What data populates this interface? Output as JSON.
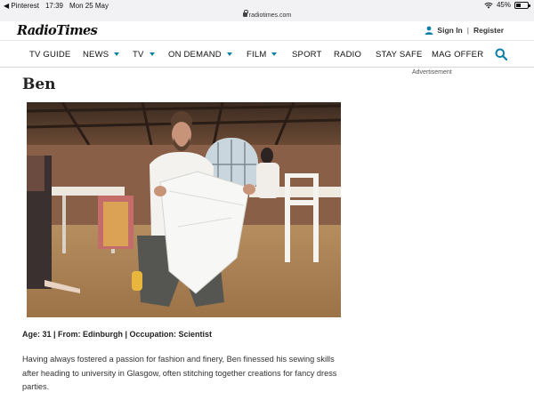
{
  "status_bar": {
    "app": "◀ Pinterest",
    "time": "17:39",
    "date": "Mon 25 May",
    "battery": "45%",
    "battery_level": 0.45
  },
  "url_bar": {
    "domain": "radiotimes.com"
  },
  "header": {
    "logo": "RadioTimes",
    "sign_in": "Sign In",
    "divider": "|",
    "register": "Register"
  },
  "nav": {
    "items": [
      {
        "label": "TV GUIDE",
        "caret": false
      },
      {
        "label": "NEWS",
        "caret": true
      },
      {
        "label": "TV",
        "caret": true
      },
      {
        "label": "ON DEMAND",
        "caret": true
      },
      {
        "label": "FILM",
        "caret": true
      },
      {
        "label": "SPORT",
        "caret": false
      },
      {
        "label": "RADIO",
        "caret": false
      },
      {
        "label": "STAY SAFE",
        "caret": false
      },
      {
        "label": "MAG OFFER",
        "caret": false
      }
    ]
  },
  "advertisement_label": "Advertisement",
  "article": {
    "title": "Ben",
    "meta": "Age: 31 | From: Edinburgh | Occupation: Scientist",
    "body": "Having always fostered a passion for fashion and finery, Ben finessed his sewing skills after heading to university in Glasgow, often stitching together creations for fancy dress parties."
  },
  "colors": {
    "accent": "#0d80a8",
    "brand_text": "#111111"
  }
}
